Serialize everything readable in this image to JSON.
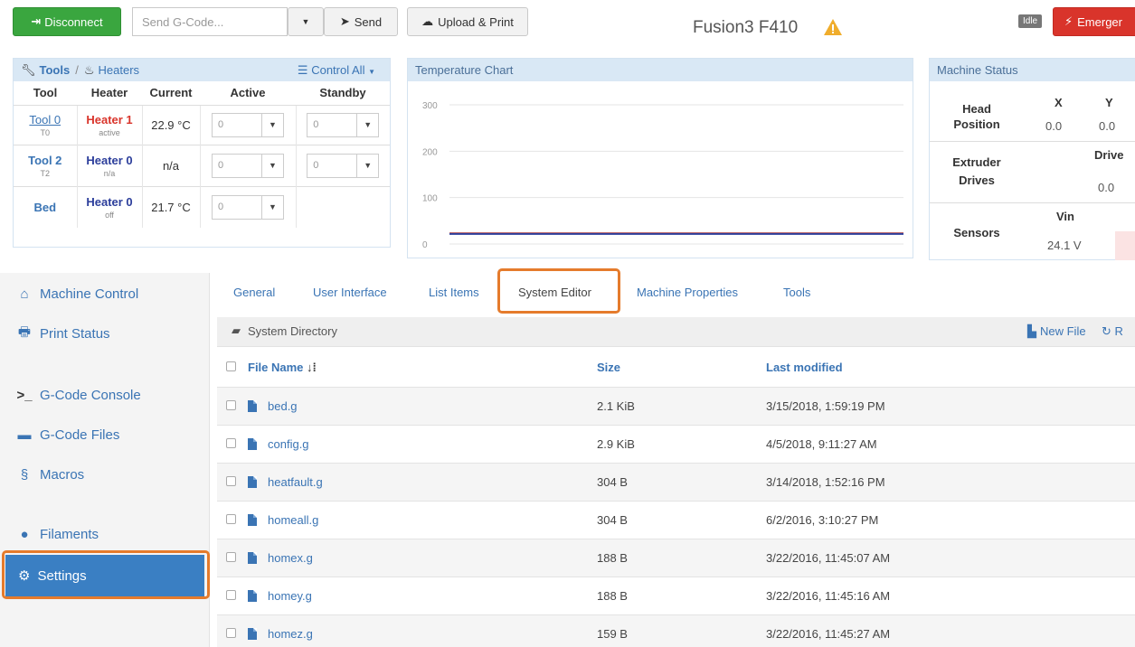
{
  "topbar": {
    "disconnect_label": "Disconnect",
    "gcode_placeholder": "Send G-Code...",
    "send_label": "Send",
    "upload_label": "Upload & Print",
    "machine_name": "Fusion3 F410",
    "status_badge": "Idle",
    "emergency_label": "Emerger"
  },
  "tools_panel": {
    "tools_label": "Tools",
    "separator": "/",
    "heaters_label": "Heaters",
    "control_all": "Control All",
    "headers": [
      "Tool",
      "Heater",
      "Current",
      "Active",
      "Standby"
    ],
    "rows": [
      {
        "tool": "Tool 0",
        "tool_sub": "T0",
        "heater": "Heater 1",
        "heater_sub": "active",
        "current": "22.9 °C",
        "active": "0",
        "standby": "0"
      },
      {
        "tool": "Tool 2",
        "tool_sub": "T2",
        "heater": "Heater 0",
        "heater_sub": "n/a",
        "current": "n/a",
        "active": "0",
        "standby": "0"
      },
      {
        "tool": "Bed",
        "heater": "Heater 0",
        "heater_sub": "off",
        "current": "21.7 °C",
        "active": "0"
      }
    ]
  },
  "temp_chart": {
    "title": "Temperature Chart",
    "y_ticks": [
      "300",
      "200",
      "100",
      "0"
    ]
  },
  "chart_data": {
    "type": "line",
    "title": "Temperature Chart",
    "ylim": [
      0,
      300
    ],
    "series": [
      {
        "color": "#c0392b",
        "values": [
          22.9,
          22.9,
          22.9,
          22.9,
          22.9
        ]
      },
      {
        "color": "#2c3e9b",
        "values": [
          21.7,
          21.7,
          21.7,
          21.7,
          21.7
        ]
      }
    ]
  },
  "machine_status": {
    "title": "Machine Status",
    "head_position": "Head Position",
    "x_label": "X",
    "y_label": "Y",
    "x_value": "0.0",
    "y_value": "0.0",
    "extruder_drives": "Extruder Drives",
    "drive_label": "Drive",
    "drive_value": "0.0",
    "sensors": "Sensors",
    "vin_label": "Vin",
    "vin_value": "24.1 V"
  },
  "sidebar": {
    "items": [
      {
        "label": "Machine Control",
        "icon": "home-icon"
      },
      {
        "label": "Print Status",
        "icon": "printer-icon"
      },
      {
        "label": "G-Code Console",
        "icon": "terminal-icon"
      },
      {
        "label": "G-Code Files",
        "icon": "hdd-icon"
      },
      {
        "label": "Macros",
        "icon": "link-icon"
      },
      {
        "label": "Filaments",
        "icon": "globe-icon"
      },
      {
        "label": "Settings",
        "icon": "gear-icon"
      }
    ]
  },
  "settings_tabs": [
    "General",
    "User Interface",
    "List Items",
    "System Editor",
    "Machine Properties",
    "Tools"
  ],
  "file_browser": {
    "directory": "System Directory",
    "new_file": "New File",
    "refresh": "R",
    "headers": {
      "name": "File Name",
      "size": "Size",
      "modified": "Last modified"
    },
    "files": [
      {
        "name": "bed.g",
        "size": "2.1 KiB",
        "modified": "3/15/2018, 1:59:19 PM"
      },
      {
        "name": "config.g",
        "size": "2.9 KiB",
        "modified": "4/5/2018, 9:11:27 AM"
      },
      {
        "name": "heatfault.g",
        "size": "304 B",
        "modified": "3/14/2018, 1:52:16 PM"
      },
      {
        "name": "homeall.g",
        "size": "304 B",
        "modified": "6/2/2016, 3:10:27 PM"
      },
      {
        "name": "homex.g",
        "size": "188 B",
        "modified": "3/22/2016, 11:45:07 AM"
      },
      {
        "name": "homey.g",
        "size": "188 B",
        "modified": "3/22/2016, 11:45:16 AM"
      },
      {
        "name": "homez.g",
        "size": "159 B",
        "modified": "3/22/2016, 11:45:27 AM"
      }
    ]
  },
  "colors": {
    "accent": "#3a74b4",
    "highlight": "#e57b2c",
    "success": "#3aa63f",
    "danger": "#d9342b"
  }
}
